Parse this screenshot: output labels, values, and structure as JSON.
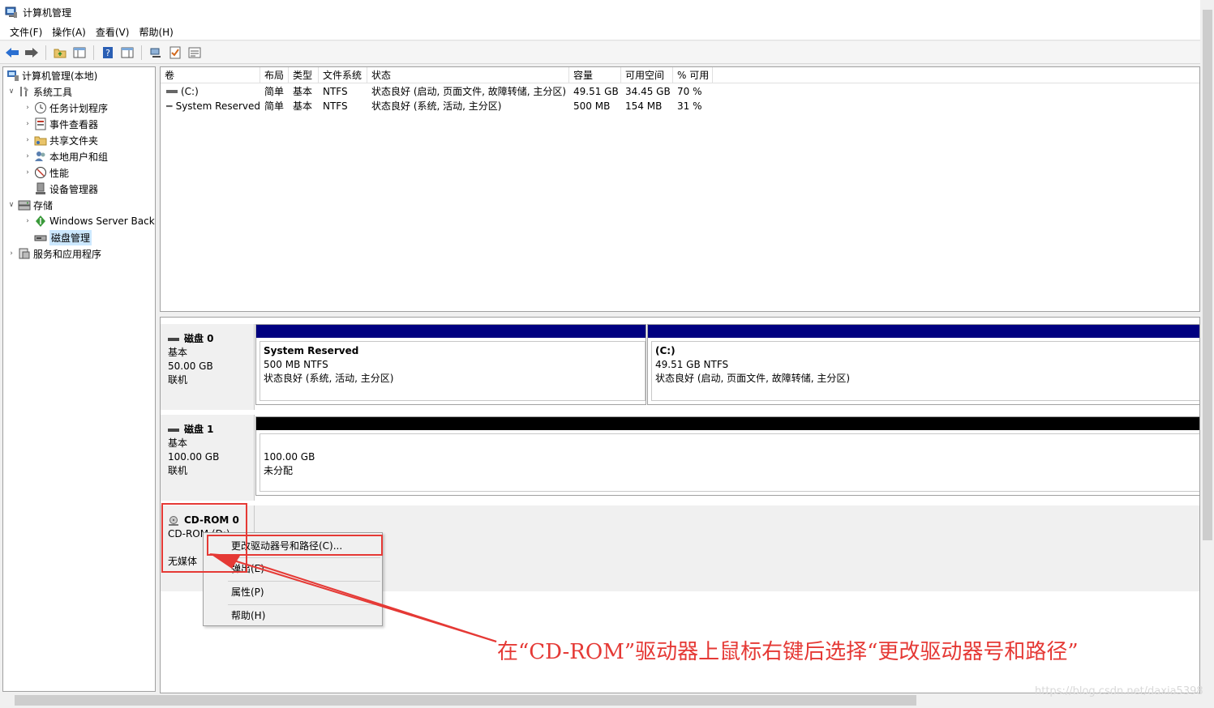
{
  "window": {
    "title": "计算机管理"
  },
  "menu": [
    "文件(F)",
    "操作(A)",
    "查看(V)",
    "帮助(H)"
  ],
  "toolbar": {
    "icons": [
      "back-icon",
      "forward-icon",
      "up-folder-icon",
      "show-tree-icon",
      "help-icon",
      "show-action-pane-icon",
      "connect-icon",
      "check-icon",
      "properties-icon"
    ]
  },
  "tree": {
    "root": "计算机管理(本地)",
    "system_tools": "系统工具",
    "task_scheduler": "任务计划程序",
    "event_viewer": "事件查看器",
    "shared_folders": "共享文件夹",
    "local_users": "本地用户和组",
    "performance": "性能",
    "device_manager": "设备管理器",
    "storage": "存储",
    "backup": "Windows Server Backup",
    "disk_mgmt": "磁盘管理",
    "services": "服务和应用程序"
  },
  "volume_table": {
    "headers": [
      "卷",
      "布局",
      "类型",
      "文件系统",
      "状态",
      "容量",
      "可用空间",
      "% 可用"
    ],
    "rows": [
      [
        "(C:)",
        "简单",
        "基本",
        "NTFS",
        "状态良好 (启动, 页面文件, 故障转储, 主分区)",
        "49.51 GB",
        "34.45 GB",
        "70 %"
      ],
      [
        "System Reserved",
        "简单",
        "基本",
        "NTFS",
        "状态良好 (系统, 活动, 主分区)",
        "500 MB",
        "154 MB",
        "31 %"
      ]
    ]
  },
  "disks": {
    "disk0": {
      "name": "磁盘 0",
      "type": "基本",
      "size": "50.00 GB",
      "state": "联机",
      "p1": {
        "name": "System Reserved",
        "size": "500 MB NTFS",
        "status": "状态良好 (系统, 活动, 主分区)"
      },
      "p2": {
        "name": "(C:)",
        "size": "49.51 GB NTFS",
        "status": "状态良好 (启动, 页面文件, 故障转储, 主分区)"
      }
    },
    "disk1": {
      "name": "磁盘 1",
      "type": "基本",
      "size": "100.00 GB",
      "state": "联机",
      "p1": {
        "size": "100.00 GB",
        "status": "未分配"
      }
    },
    "cdrom": {
      "name": "CD-ROM 0",
      "drive": "CD-ROM (D:)",
      "media": "无媒体"
    }
  },
  "context_menu": {
    "change_letter": "更改驱动器号和路径(C)...",
    "eject": "弹出(E)",
    "properties": "属性(P)",
    "help": "帮助(H)"
  },
  "annotation": "在“CD-ROM”驱动器上鼠标右键后选择“更改驱动器号和路径”",
  "watermark": "https://blog.csdn.net/daxia5398",
  "colors": {
    "primary_bar": "#000080",
    "unallocated_bar": "#000000",
    "annotation": "#e53935",
    "selection": "#cce8ff"
  }
}
